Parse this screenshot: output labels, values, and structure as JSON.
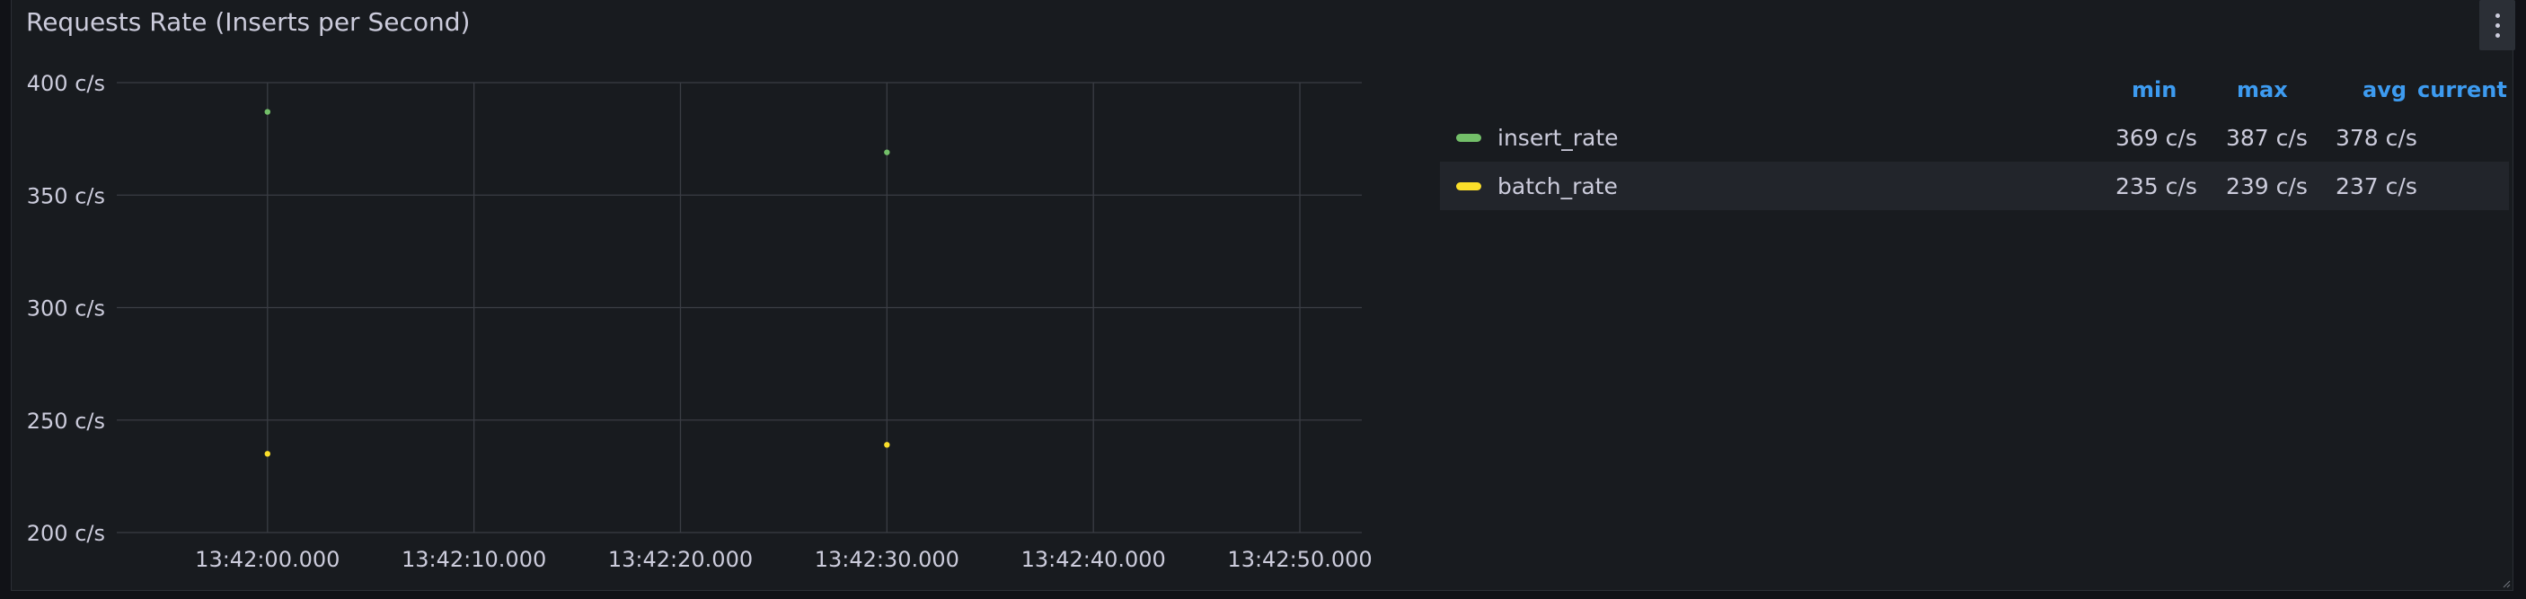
{
  "panel": {
    "title": "Requests Rate (Inserts per Second)"
  },
  "legend": {
    "headers": {
      "min": "min",
      "max": "max",
      "avg": "avg",
      "current": "current"
    },
    "rows": [
      {
        "name": "insert_rate",
        "color": "#73bf69",
        "min": "369 c/s",
        "max": "387 c/s",
        "avg": "378 c/s",
        "current": ""
      },
      {
        "name": "batch_rate",
        "color": "#fade2a",
        "min": "235 c/s",
        "max": "239 c/s",
        "avg": "237 c/s",
        "current": ""
      }
    ]
  },
  "chart_data": {
    "type": "scatter",
    "title": "Requests Rate (Inserts per Second)",
    "xlabel": "",
    "ylabel": "",
    "ylim": [
      200,
      400
    ],
    "y_unit": "c/s",
    "y_ticks": [
      "400 c/s",
      "350 c/s",
      "300 c/s",
      "250 c/s",
      "200 c/s"
    ],
    "y_tick_values": [
      400,
      350,
      300,
      250,
      200
    ],
    "x_ticks": [
      "13:42:00.000",
      "13:42:10.000",
      "13:42:20.000",
      "13:42:30.000",
      "13:42:40.000",
      "13:42:50.000"
    ],
    "x_tick_values": [
      "13:42:00",
      "13:42:10",
      "13:42:20",
      "13:42:30",
      "13:42:40",
      "13:42:50"
    ],
    "xlim": [
      "13:41:52.7",
      "13:42:53"
    ],
    "grid": true,
    "legend_position": "right",
    "series": [
      {
        "name": "insert_rate",
        "color": "#73bf69",
        "points": [
          {
            "x": "13:42:00",
            "y": 387
          },
          {
            "x": "13:42:30",
            "y": 369
          }
        ]
      },
      {
        "name": "batch_rate",
        "color": "#fade2a",
        "points": [
          {
            "x": "13:42:00",
            "y": 235
          },
          {
            "x": "13:42:30",
            "y": 239
          }
        ]
      }
    ]
  }
}
